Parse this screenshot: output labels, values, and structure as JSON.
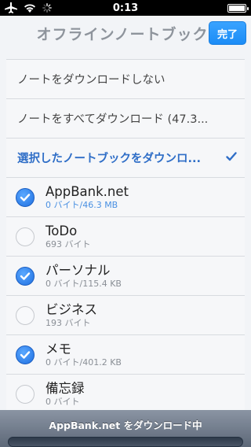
{
  "status_bar": {
    "time": "0:13",
    "icons": [
      "airplane-icon",
      "wifi-icon",
      "activity-spinner-icon",
      "battery-icon"
    ]
  },
  "nav": {
    "title": "オフラインノートブック",
    "done_label": "完了"
  },
  "options": [
    {
      "label": "ノートをダウンロードしない",
      "selected": false
    },
    {
      "label": "ノートをすべてダウンロード (47.3...",
      "selected": false
    },
    {
      "label": "選択したノートブックをダウンロ...",
      "selected": true
    }
  ],
  "notebooks": [
    {
      "name": "AppBank.net",
      "size": "0 バイト/46.3 MB",
      "checked": true,
      "active": true
    },
    {
      "name": "ToDo",
      "size": "693 バイト",
      "checked": false,
      "active": false
    },
    {
      "name": "パーソナル",
      "size": "0 バイト/115.4 KB",
      "checked": true,
      "active": false
    },
    {
      "name": "ビジネス",
      "size": "193 バイト",
      "checked": false,
      "active": false
    },
    {
      "name": "メモ",
      "size": "0 バイト/401.2 KB",
      "checked": true,
      "active": false
    },
    {
      "name": "備忘録",
      "size": "0 バイト",
      "checked": false,
      "active": false
    }
  ],
  "progress": {
    "label": "AppBank.net をダウンロード中",
    "fraction": 0.0
  },
  "colors": {
    "accent": "#1b8cf6",
    "selected_text": "#2f6ec7",
    "progress_fill": "#3d8ae6"
  }
}
